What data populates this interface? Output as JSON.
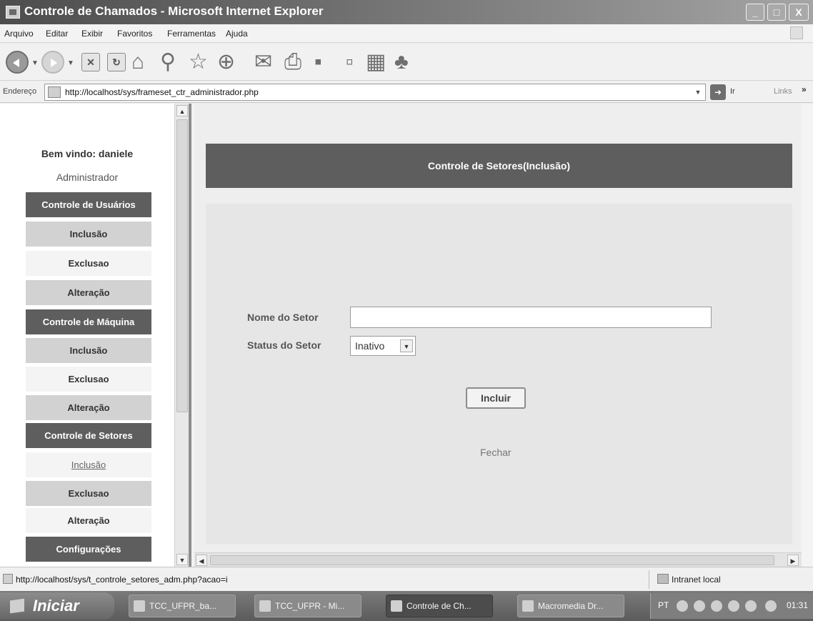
{
  "window": {
    "title": "Controle de Chamados - Microsoft Internet Explorer",
    "controls": {
      "minimize": "_",
      "maximize": "□",
      "close": "X"
    }
  },
  "menubar": [
    "Arquivo",
    "Editar",
    "Exibir",
    "Favoritos",
    "Ferramentas",
    "Ajuda"
  ],
  "address_bar": {
    "label": "Endereço",
    "url": "http://localhost/sys/frameset_ctr_administrador.php",
    "go_label": "Ir",
    "links_label": "Links"
  },
  "sidebar": {
    "welcome": "Bem vindo: daniele",
    "role": "Administrador",
    "sections": [
      {
        "title": "Controle de Usuários",
        "items": [
          "Inclusão",
          "Exclusao",
          "Alteração"
        ]
      },
      {
        "title": "Controle de Máquina",
        "items": [
          "Inclusão",
          "Exclusao",
          "Alteração"
        ]
      },
      {
        "title": "Controle de Setores",
        "items": [
          "Inclusão",
          "Exclusao",
          "Alteração"
        ]
      },
      {
        "title": "Configurações",
        "items": []
      }
    ]
  },
  "main": {
    "header": "Controle de Setores(Inclusão)",
    "form": {
      "name_label": "Nome do Setor",
      "name_value": "",
      "status_label": "Status do Setor",
      "status_value": "Inativo",
      "submit_label": "Incluir"
    },
    "close_link": "Fechar"
  },
  "statusbar": {
    "url": "http://localhost/sys/t_controle_setores_adm.php?acao=i",
    "zone": "Intranet local"
  },
  "taskbar": {
    "start": "Iniciar",
    "tasks": [
      "TCC_UFPR_ba...",
      "TCC_UFPR - Mi...",
      "Controle de Ch...",
      "Macromedia Dr..."
    ],
    "active_task": 2,
    "tray_lang": "PT",
    "clock": "01:31"
  },
  "icons": {
    "toolbar": [
      "back-icon",
      "forward-icon",
      "stop-icon",
      "refresh-icon",
      "home-icon",
      "search-icon",
      "favorites-icon",
      "history-icon",
      "mail-icon",
      "print-icon",
      "edit-icon",
      "discuss-icon",
      "research-icon",
      "messenger-icon"
    ]
  }
}
